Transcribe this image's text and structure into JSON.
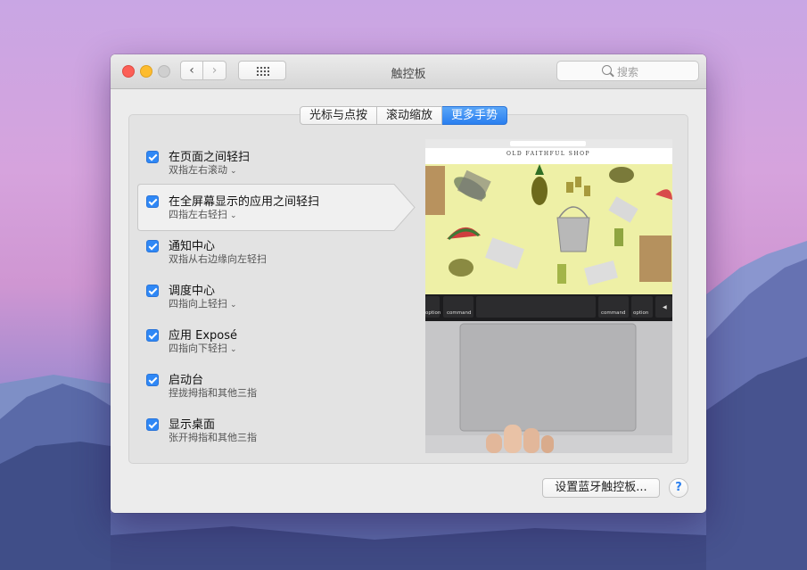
{
  "window": {
    "title": "触控板"
  },
  "search": {
    "placeholder": "搜索"
  },
  "tabs": [
    {
      "label": "光标与点按"
    },
    {
      "label": "滚动缩放"
    },
    {
      "label": "更多手势",
      "active": true
    }
  ],
  "gestures": [
    {
      "title": "在页面之间轻扫",
      "detail": "双指左右滚动",
      "checked": true,
      "dropdown": true
    },
    {
      "title": "在全屏幕显示的应用之间轻扫",
      "detail": "四指左右轻扫",
      "checked": true,
      "dropdown": true,
      "selected": true
    },
    {
      "title": "通知中心",
      "detail": "双指从右边缘向左轻扫",
      "checked": true,
      "dropdown": false
    },
    {
      "title": "调度中心",
      "detail": "四指向上轻扫",
      "checked": true,
      "dropdown": true
    },
    {
      "title": "应用 Exposé",
      "detail": "四指向下轻扫",
      "checked": true,
      "dropdown": true
    },
    {
      "title": "启动台",
      "detail": "捏拢拇指和其他三指",
      "checked": true,
      "dropdown": false
    },
    {
      "title": "显示桌面",
      "detail": "张开拇指和其他三指",
      "checked": true,
      "dropdown": false
    }
  ],
  "preview": {
    "shop_name": "OLD FAITHFUL SHOP",
    "keys": [
      "option",
      "command",
      "command",
      "option"
    ]
  },
  "footer": {
    "bluetooth_button": "设置蓝牙触控板...",
    "help": "?"
  },
  "colors": {
    "accent": "#2f88f6",
    "traffic_red": "#fc5f57",
    "traffic_yellow": "#fdbc2e"
  }
}
